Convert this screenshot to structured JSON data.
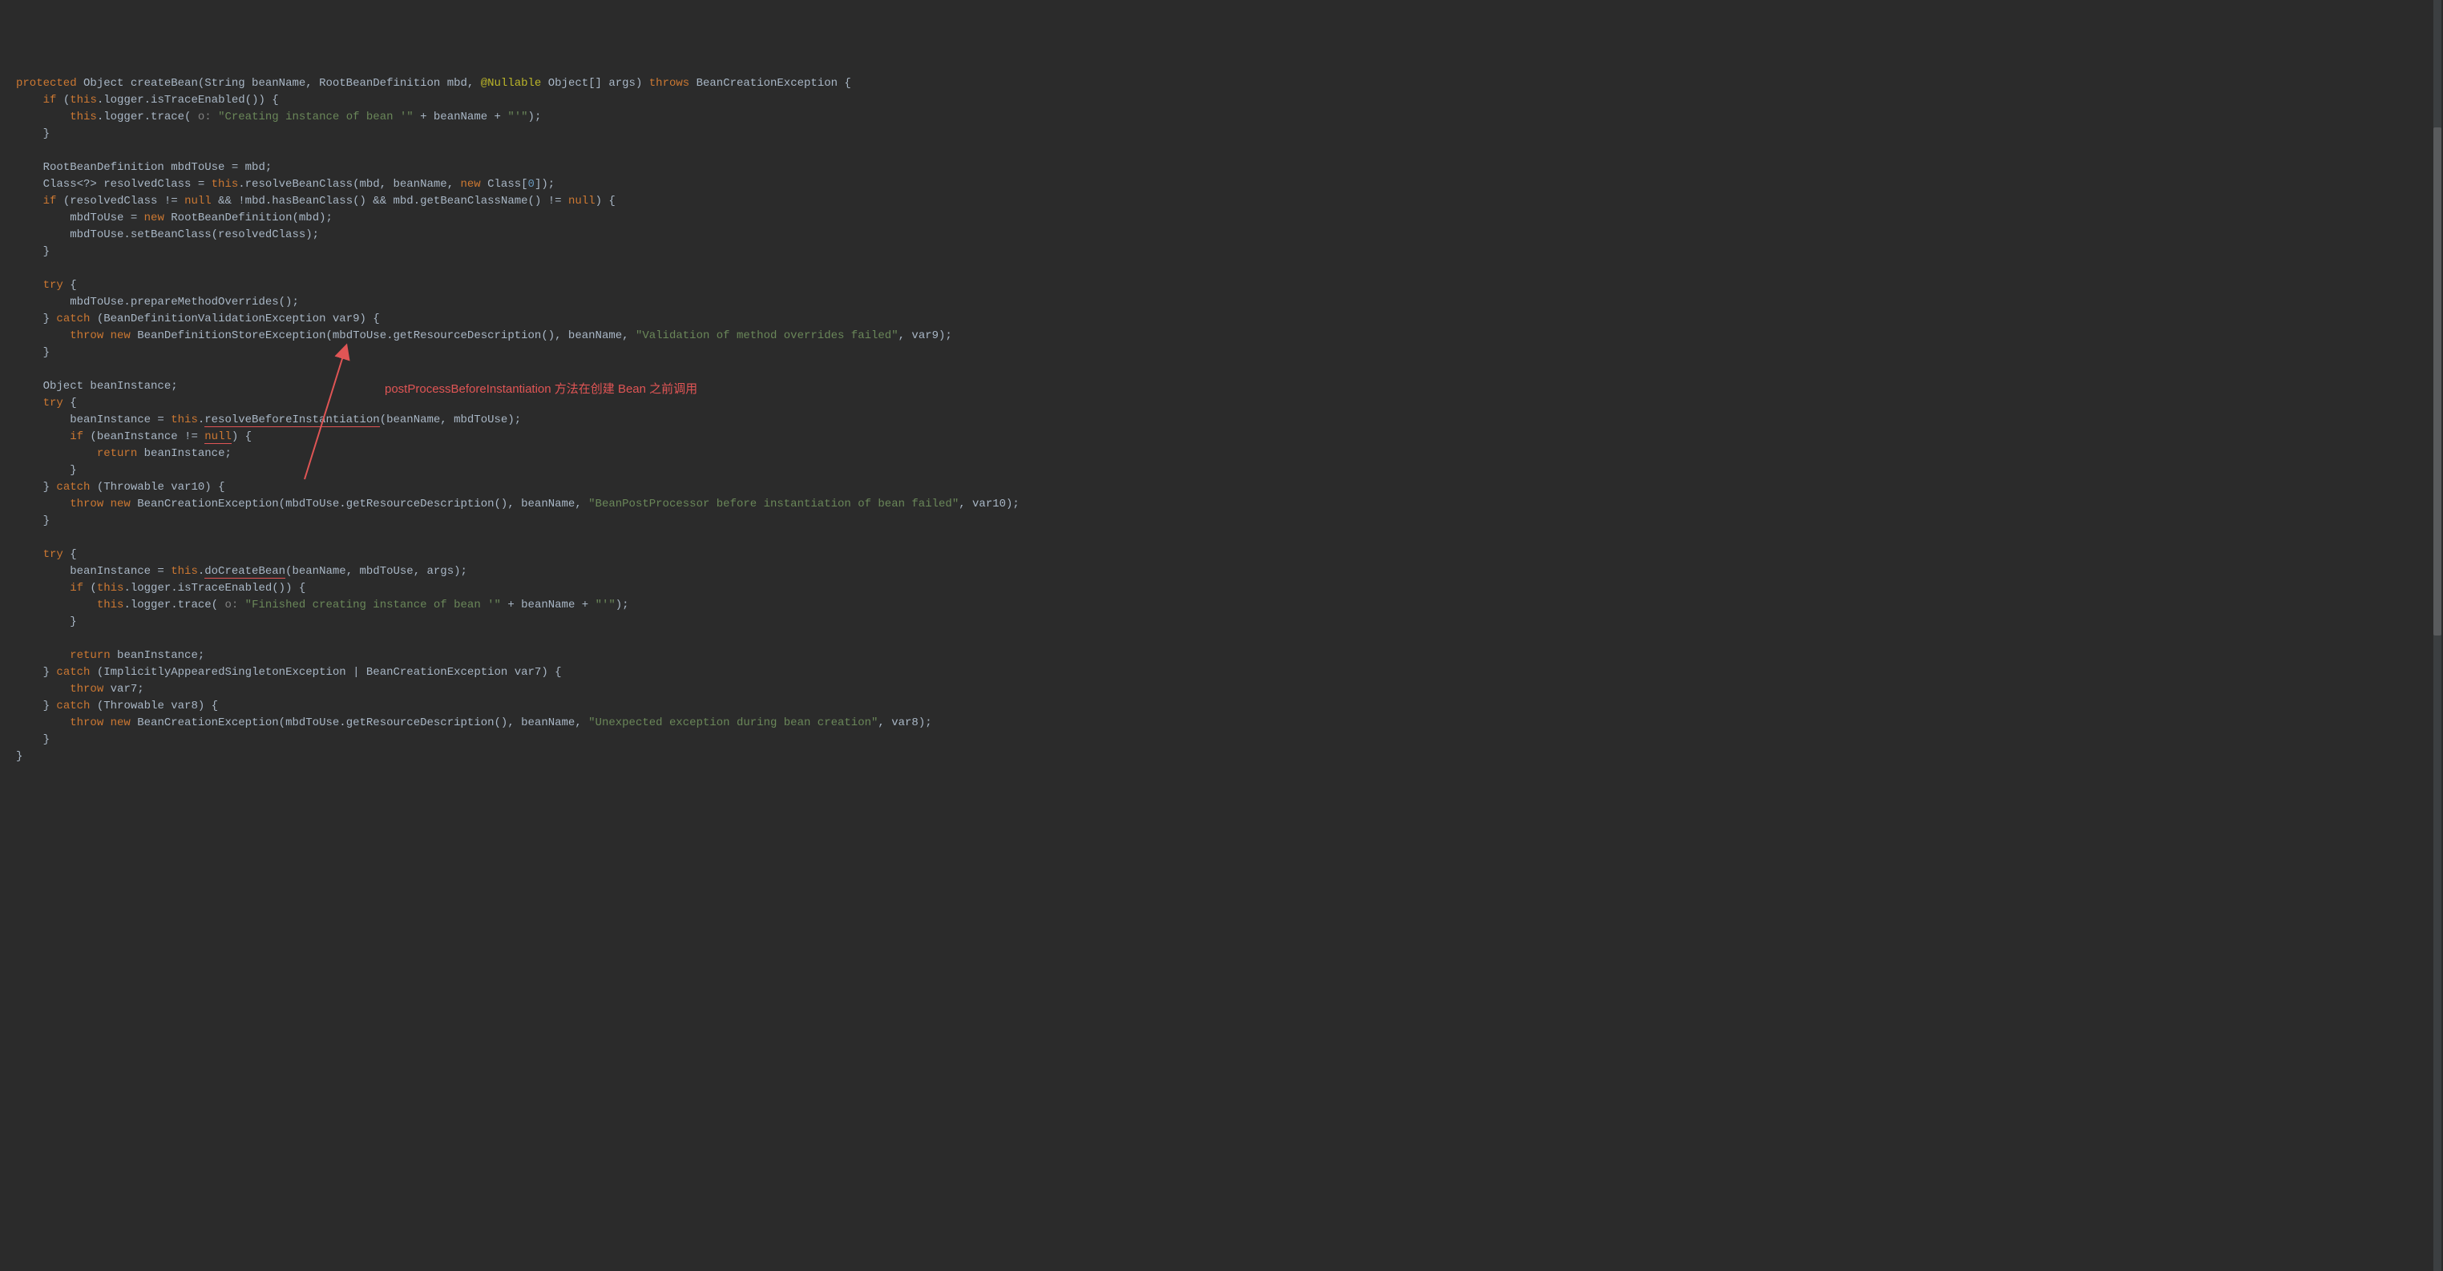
{
  "code": {
    "l1_protected": "protected",
    "l1_rest": " Object createBean(String beanName, RootBeanDefinition mbd, ",
    "l1_ann": "@Nullable",
    "l1_rest2": " Object[] args) ",
    "l1_throws": "throws",
    "l1_rest3": " BeanCreationException {",
    "l2_if": "if",
    "l2_rest": " (",
    "l2_this": "this",
    "l2_rest2": ".logger.isTraceEnabled()) {",
    "l3_this": "this",
    "l3_rest": ".logger.trace(",
    "l3_hint": " o: ",
    "l3_str": "\"Creating instance of bean '\"",
    "l3_rest2": " + beanName + ",
    "l3_str2": "\"'\"",
    "l3_rest3": ");",
    "l4": "    }",
    "l5": "",
    "l6": "    RootBeanDefinition mbdToUse = mbd;",
    "l7_pre": "    Class<?> resolvedClass = ",
    "l7_this": "this",
    "l7_rest": ".resolveBeanClass(mbd, beanName, ",
    "l7_new": "new",
    "l7_rest2": " Class[",
    "l7_num": "0",
    "l7_rest3": "]);",
    "l8_if": "if",
    "l8_rest": " (resolvedClass != ",
    "l8_null": "null",
    "l8_rest2": " && !mbd.hasBeanClass() && mbd.getBeanClassName() != ",
    "l8_null2": "null",
    "l8_rest3": ") {",
    "l9_pre": "        mbdToUse = ",
    "l9_new": "new",
    "l9_rest": " RootBeanDefinition(mbd);",
    "l10": "        mbdToUse.setBeanClass(resolvedClass);",
    "l11": "    }",
    "l13_try": "try",
    "l13_rest": " {",
    "l14": "        mbdToUse.prepareMethodOverrides();",
    "l15_catch": "catch",
    "l15_rest": " (BeanDefinitionValidationException var9) {",
    "l16_throw": "throw new",
    "l16_rest": " BeanDefinitionStoreException(mbdToUse.getResourceDescription(), beanName, ",
    "l16_str": "\"Validation of method overrides failed\"",
    "l16_rest2": ", var9);",
    "l17": "    }",
    "l19": "    Object beanInstance;",
    "l20_try": "try",
    "l20_rest": " {",
    "l21_pre": "        beanInstance = ",
    "l21_this": "this",
    "l21_dot": ".",
    "l21_method": "resolveBeforeInstantiation",
    "l21_rest": "(beanName, mbdToUse);",
    "l22_if": "if",
    "l22_rest": " (beanInstance != ",
    "l22_null": "null",
    "l22_rest2": ") {",
    "l23_return": "return",
    "l23_rest": " beanInstance;",
    "l24": "        }",
    "l25_catch": "catch",
    "l25_rest": " (Throwable var10) {",
    "l26_throw": "throw new",
    "l26_rest": " BeanCreationException(mbdToUse.getResourceDescription(), beanName, ",
    "l26_str": "\"BeanPostProcessor before instantiation of bean failed\"",
    "l26_rest2": ", var10);",
    "l27": "    }",
    "l29_try": "try",
    "l29_rest": " {",
    "l30_pre": "        beanInstance = ",
    "l30_this": "this",
    "l30_dot": ".",
    "l30_method": "doCreateBean",
    "l30_rest": "(beanName, mbdToUse, args);",
    "l31_if": "if",
    "l31_rest": " (",
    "l31_this": "this",
    "l31_rest2": ".logger.isTraceEnabled()) {",
    "l32_this": "this",
    "l32_rest": ".logger.trace(",
    "l32_hint": " o: ",
    "l32_str": "\"Finished creating instance of bean '\"",
    "l32_rest2": " + beanName + ",
    "l32_str2": "\"'\"",
    "l32_rest3": ");",
    "l33": "        }",
    "l35_return": "return",
    "l35_rest": " beanInstance;",
    "l36_catch": "catch",
    "l36_rest": " (ImplicitlyAppearedSingletonException | BeanCreationException var7) {",
    "l37_throw": "throw",
    "l37_rest": " var7;",
    "l38_catch": "catch",
    "l38_rest": " (Throwable var8) {",
    "l39_throw": "throw new",
    "l39_rest": " BeanCreationException(mbdToUse.getResourceDescription(), beanName, ",
    "l39_str": "\"Unexpected exception during bean creation\"",
    "l39_rest2": ", var8);",
    "l40": "    }",
    "l41": "}"
  },
  "annotation": {
    "label": "postProcessBeforeInstantiation 方法在创建 Bean 之前调用"
  }
}
